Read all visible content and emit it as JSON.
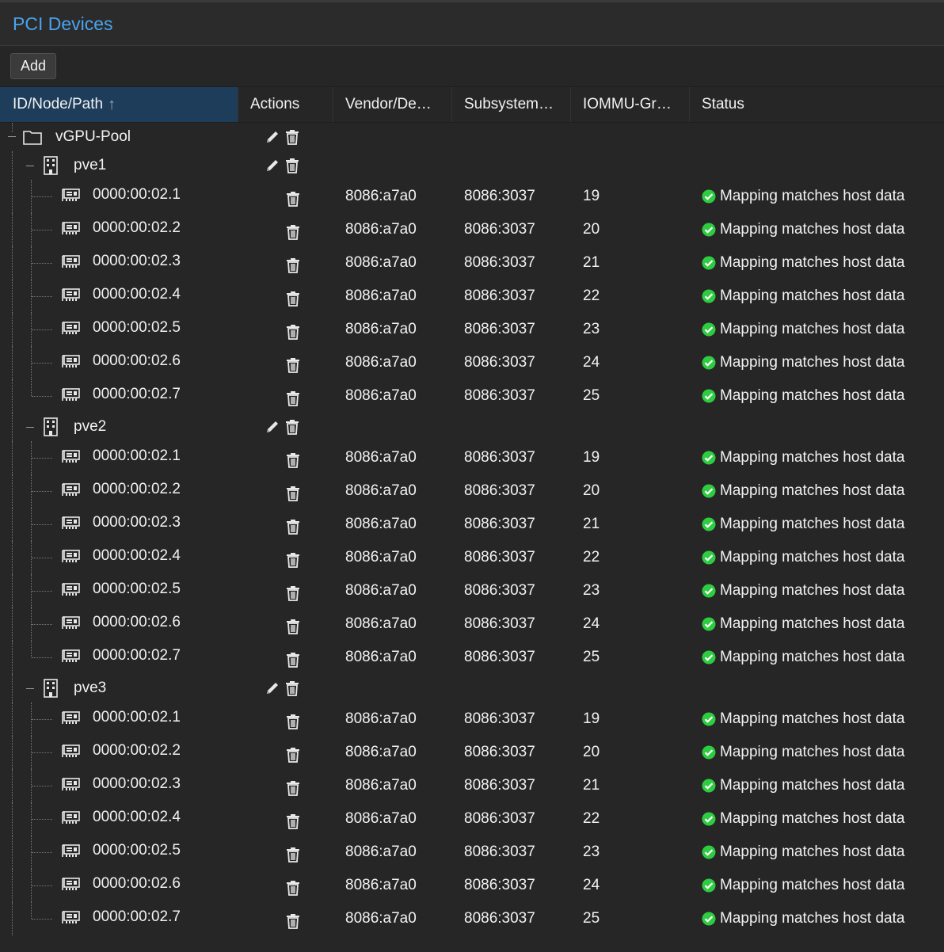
{
  "panel": {
    "title": "PCI Devices"
  },
  "toolbar": {
    "add_label": "Add"
  },
  "columns": [
    "ID/Node/Path",
    "Actions",
    "Vendor/De…",
    "Subsystem…",
    "IOMMU-Gr…",
    "Status"
  ],
  "icons": {
    "pool": "folder-icon",
    "node": "server-building-icon",
    "device": "pci-card-icon",
    "edit": "pencil-icon",
    "delete": "trash-icon",
    "status": "check-circle-icon"
  },
  "colors": {
    "title": "#4aa3f0",
    "status_ok": "#2ecc40",
    "sorted_header": "#1d3d5a"
  },
  "tree": {
    "pool": "vGPU-Pool",
    "nodes": [
      {
        "name": "pve1",
        "devices": [
          {
            "path": "0000:00:02.1",
            "vendor": "8086:a7a0",
            "subsystem": "8086:3037",
            "iommu": "19",
            "status": "Mapping matches host data"
          },
          {
            "path": "0000:00:02.2",
            "vendor": "8086:a7a0",
            "subsystem": "8086:3037",
            "iommu": "20",
            "status": "Mapping matches host data"
          },
          {
            "path": "0000:00:02.3",
            "vendor": "8086:a7a0",
            "subsystem": "8086:3037",
            "iommu": "21",
            "status": "Mapping matches host data"
          },
          {
            "path": "0000:00:02.4",
            "vendor": "8086:a7a0",
            "subsystem": "8086:3037",
            "iommu": "22",
            "status": "Mapping matches host data"
          },
          {
            "path": "0000:00:02.5",
            "vendor": "8086:a7a0",
            "subsystem": "8086:3037",
            "iommu": "23",
            "status": "Mapping matches host data"
          },
          {
            "path": "0000:00:02.6",
            "vendor": "8086:a7a0",
            "subsystem": "8086:3037",
            "iommu": "24",
            "status": "Mapping matches host data"
          },
          {
            "path": "0000:00:02.7",
            "vendor": "8086:a7a0",
            "subsystem": "8086:3037",
            "iommu": "25",
            "status": "Mapping matches host data"
          }
        ]
      },
      {
        "name": "pve2",
        "devices": [
          {
            "path": "0000:00:02.1",
            "vendor": "8086:a7a0",
            "subsystem": "8086:3037",
            "iommu": "19",
            "status": "Mapping matches host data"
          },
          {
            "path": "0000:00:02.2",
            "vendor": "8086:a7a0",
            "subsystem": "8086:3037",
            "iommu": "20",
            "status": "Mapping matches host data"
          },
          {
            "path": "0000:00:02.3",
            "vendor": "8086:a7a0",
            "subsystem": "8086:3037",
            "iommu": "21",
            "status": "Mapping matches host data"
          },
          {
            "path": "0000:00:02.4",
            "vendor": "8086:a7a0",
            "subsystem": "8086:3037",
            "iommu": "22",
            "status": "Mapping matches host data"
          },
          {
            "path": "0000:00:02.5",
            "vendor": "8086:a7a0",
            "subsystem": "8086:3037",
            "iommu": "23",
            "status": "Mapping matches host data"
          },
          {
            "path": "0000:00:02.6",
            "vendor": "8086:a7a0",
            "subsystem": "8086:3037",
            "iommu": "24",
            "status": "Mapping matches host data"
          },
          {
            "path": "0000:00:02.7",
            "vendor": "8086:a7a0",
            "subsystem": "8086:3037",
            "iommu": "25",
            "status": "Mapping matches host data"
          }
        ]
      },
      {
        "name": "pve3",
        "devices": [
          {
            "path": "0000:00:02.1",
            "vendor": "8086:a7a0",
            "subsystem": "8086:3037",
            "iommu": "19",
            "status": "Mapping matches host data"
          },
          {
            "path": "0000:00:02.2",
            "vendor": "8086:a7a0",
            "subsystem": "8086:3037",
            "iommu": "20",
            "status": "Mapping matches host data"
          },
          {
            "path": "0000:00:02.3",
            "vendor": "8086:a7a0",
            "subsystem": "8086:3037",
            "iommu": "21",
            "status": "Mapping matches host data"
          },
          {
            "path": "0000:00:02.4",
            "vendor": "8086:a7a0",
            "subsystem": "8086:3037",
            "iommu": "22",
            "status": "Mapping matches host data"
          },
          {
            "path": "0000:00:02.5",
            "vendor": "8086:a7a0",
            "subsystem": "8086:3037",
            "iommu": "23",
            "status": "Mapping matches host data"
          },
          {
            "path": "0000:00:02.6",
            "vendor": "8086:a7a0",
            "subsystem": "8086:3037",
            "iommu": "24",
            "status": "Mapping matches host data"
          },
          {
            "path": "0000:00:02.7",
            "vendor": "8086:a7a0",
            "subsystem": "8086:3037",
            "iommu": "25",
            "status": "Mapping matches host data"
          }
        ]
      }
    ]
  }
}
